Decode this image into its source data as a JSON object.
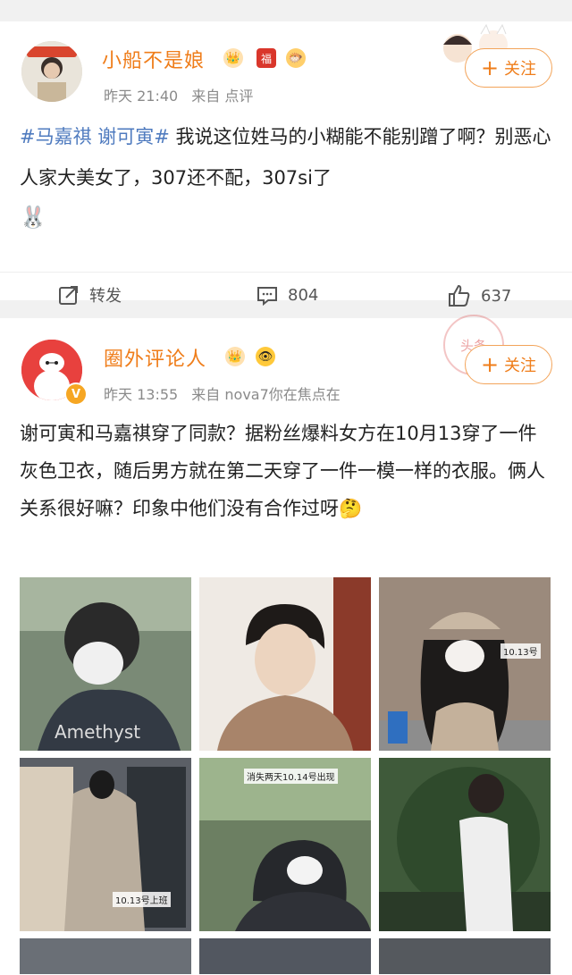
{
  "post1": {
    "user_name": "小船不是娘",
    "time": "昨天 21:40",
    "source": "来自 点评",
    "hashtag": "#马嘉祺 谢可寅#",
    "text": " 我说这位姓马的小糊能不能别蹭了啊？别恶心人家大美女了，307还不配，307si了",
    "badge_vip": "👑",
    "badge_fu": "福",
    "badge_fish": "🐡",
    "sticker": "🐰",
    "follow_label": "关注",
    "repost_label": "转发",
    "comment_count": "804",
    "like_count": "637"
  },
  "post2": {
    "user_name": "圈外评论人",
    "time": "昨天 13:55",
    "source": "来自 nova7你在焦点在",
    "text": "谢可寅和马嘉祺穿了同款？据粉丝爆料女方在10月13穿了一件灰色卫衣，随后男方就在第二天穿了一件一模一样的衣服。俩人关系很好嘛？印象中他们没有合作过呀",
    "emoji": "🤔",
    "badge_vip": "👑",
    "badge_eye": "👁",
    "verified": "V",
    "follow_label": "关注",
    "stamp": "头条",
    "images": [
      {
        "caption": "Amethyst"
      },
      {
        "caption": ""
      },
      {
        "caption": "10.13号"
      },
      {
        "caption": "10.13号上班"
      },
      {
        "caption": "消失两天10.14号出现"
      },
      {
        "caption": ""
      }
    ]
  },
  "colors": {
    "accent": "#ef7d1a",
    "link": "#4f7bbf",
    "meta": "#8a8a8a"
  }
}
